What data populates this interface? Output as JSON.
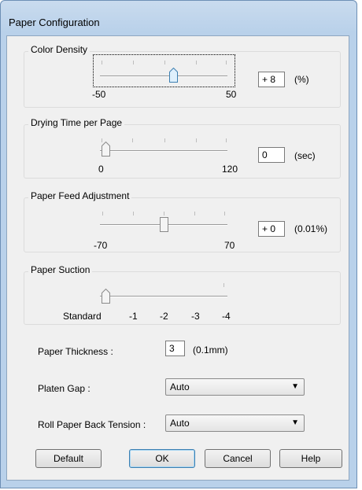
{
  "window": {
    "title": "Paper Configuration"
  },
  "color_density": {
    "label": "Color Density",
    "min": "-50",
    "max": "50",
    "value": "+ 8",
    "unit": "(%)",
    "level": 0.58
  },
  "drying_time": {
    "label": "Drying Time per Page",
    "min": "0",
    "max": "120",
    "value": "0",
    "unit": "(sec)",
    "level": 0.0
  },
  "paper_feed": {
    "label": "Paper Feed Adjustment",
    "min": "-70",
    "max": "70",
    "value": "+ 0",
    "unit": "(0.01%)",
    "level": 0.5
  },
  "paper_suction": {
    "label": "Paper Suction",
    "scale": [
      "Standard",
      "-1",
      "-2",
      "-3",
      "-4"
    ],
    "level": 0.0
  },
  "paper_thickness": {
    "label": "Paper Thickness :",
    "value": "3",
    "unit": "(0.1mm)"
  },
  "platen_gap": {
    "label": "Platen Gap :",
    "value": "Auto"
  },
  "roll_tension": {
    "label": "Roll Paper Back Tension :",
    "value": "Auto"
  },
  "buttons": {
    "default": "Default",
    "ok": "OK",
    "cancel": "Cancel",
    "help": "Help"
  }
}
